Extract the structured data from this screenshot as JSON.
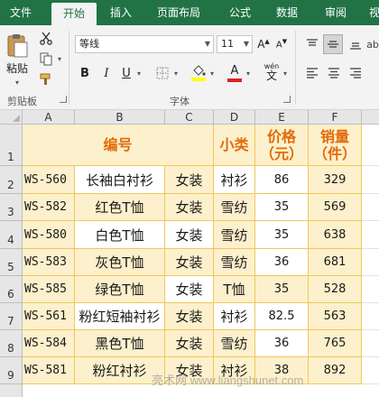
{
  "ribbon_tabs": [
    "文件",
    "开始",
    "插入",
    "页面布局",
    "公式",
    "数据",
    "审阅",
    "视"
  ],
  "active_tab": "开始",
  "clipboard": {
    "paste_label": "粘贴",
    "group_label": "剪贴板"
  },
  "font": {
    "name": "等线",
    "size": "11",
    "bold": "B",
    "italic": "I",
    "underline": "U",
    "font_color_glyph": "A",
    "phonetic_glyph": "wén",
    "group_label": "字体"
  },
  "colors": {
    "ribbon_green": "#217346",
    "header_orange": "#e26b0a",
    "cell_fill": "#fdf0cc",
    "cell_border": "#f0c85a",
    "font_color_red": "#e02020",
    "fill_yellow": "#ffff00"
  },
  "icons": [
    "paste-icon",
    "cut-icon",
    "copy-icon",
    "format-painter-icon",
    "increase-font-icon",
    "decrease-font-icon",
    "bold-icon",
    "italic-icon",
    "underline-icon",
    "border-icon",
    "fill-color-icon",
    "font-color-icon",
    "phonetic-icon",
    "align-top-icon",
    "align-middle-icon",
    "align-bottom-icon",
    "align-left-icon",
    "align-center-icon",
    "align-right-icon"
  ],
  "sheet": {
    "columns": [
      "A",
      "B",
      "C",
      "D",
      "E",
      "F"
    ],
    "rows": [
      "1",
      "2",
      "3",
      "4",
      "5",
      "6",
      "7",
      "8",
      "9"
    ],
    "header": {
      "code": "编号",
      "category": "小类",
      "price": "价格\n（元）",
      "sales": "销量\n（件）"
    },
    "data": [
      [
        "WS-560",
        "长袖白衬衫",
        "女装",
        "衬衫",
        "86",
        "329"
      ],
      [
        "WS-582",
        "红色T恤",
        "女装",
        "雪纺",
        "35",
        "569"
      ],
      [
        "WS-580",
        "白色T恤",
        "女装",
        "雪纺",
        "35",
        "638"
      ],
      [
        "WS-583",
        "灰色T恤",
        "女装",
        "雪纺",
        "36",
        "681"
      ],
      [
        "WS-585",
        "绿色T恤",
        "女装",
        "T恤",
        "35",
        "528"
      ],
      [
        "WS-561",
        "粉红短袖衬衫",
        "女装",
        "衬衫",
        "82.5",
        "563"
      ],
      [
        "WS-584",
        "黑色T恤",
        "女装",
        "雪纺",
        "36",
        "765"
      ],
      [
        "WS-581",
        "粉红衬衫",
        "女装",
        "衬衫",
        "38",
        "892"
      ]
    ]
  },
  "watermark": "亮术网 www.liangshunet.com"
}
